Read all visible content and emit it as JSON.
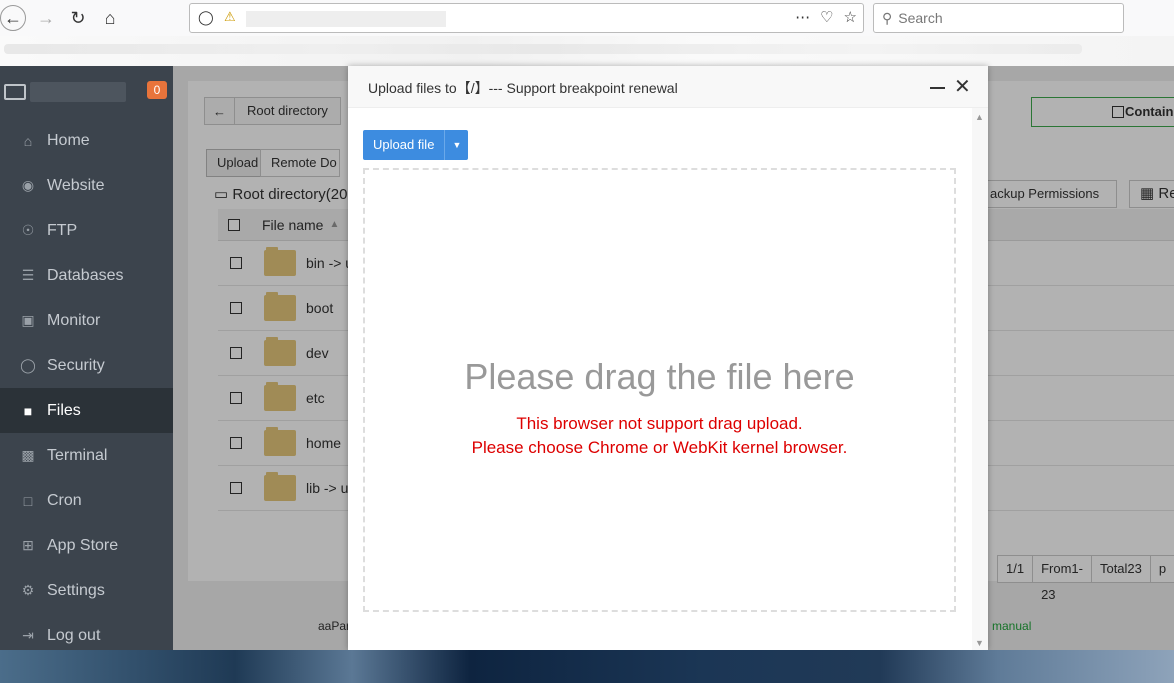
{
  "browser": {
    "search_placeholder": "Search",
    "back_icon": "back-arrow-icon",
    "forward_icon": "forward-arrow-icon",
    "reload_icon": "reload-icon",
    "home_icon": "home-icon"
  },
  "sidebar": {
    "notification_count": "0",
    "items": [
      {
        "label": "Home",
        "icon": "home-icon"
      },
      {
        "label": "Website",
        "icon": "globe-icon"
      },
      {
        "label": "FTP",
        "icon": "ftp-icon"
      },
      {
        "label": "Databases",
        "icon": "database-icon"
      },
      {
        "label": "Monitor",
        "icon": "monitor-icon"
      },
      {
        "label": "Security",
        "icon": "shield-icon"
      },
      {
        "label": "Files",
        "icon": "folder-icon"
      },
      {
        "label": "Terminal",
        "icon": "terminal-icon"
      },
      {
        "label": "Cron",
        "icon": "clock-icon"
      },
      {
        "label": "App Store",
        "icon": "grid-icon"
      },
      {
        "label": "Settings",
        "icon": "gear-icon"
      },
      {
        "label": "Log out",
        "icon": "logout-icon"
      }
    ],
    "active": "Files"
  },
  "files": {
    "breadcrumb": "Root directory",
    "upload_label": "Upload",
    "remote_label": "Remote Do",
    "root_label": "Root directory(20",
    "contain_label": "Contain",
    "backup_permissions_label": "ackup Permissions",
    "recycle_label": "Recy",
    "column_filename": "File name",
    "rows": [
      "bin -> usr",
      "boot",
      "dev",
      "etc",
      "home",
      "lib -> usr/"
    ],
    "pager": [
      "1/1",
      "From1-23",
      "Total23",
      "p"
    ],
    "footer": "aaPan",
    "manual": "manual"
  },
  "modal": {
    "title": "Upload files to【/】--- Support breakpoint renewal",
    "upload_button": "Upload file",
    "drop_title": "Please drag the file here",
    "warning_line1": "This browser not support drag upload.",
    "warning_line2": "Please choose Chrome or WebKit kernel browser."
  },
  "colors": {
    "sidebar_bg": "#3c444d",
    "accent_blue": "#3d8ce0",
    "warning_red": "#dd0000",
    "badge_orange": "#e8743b",
    "green": "#20a53a"
  }
}
